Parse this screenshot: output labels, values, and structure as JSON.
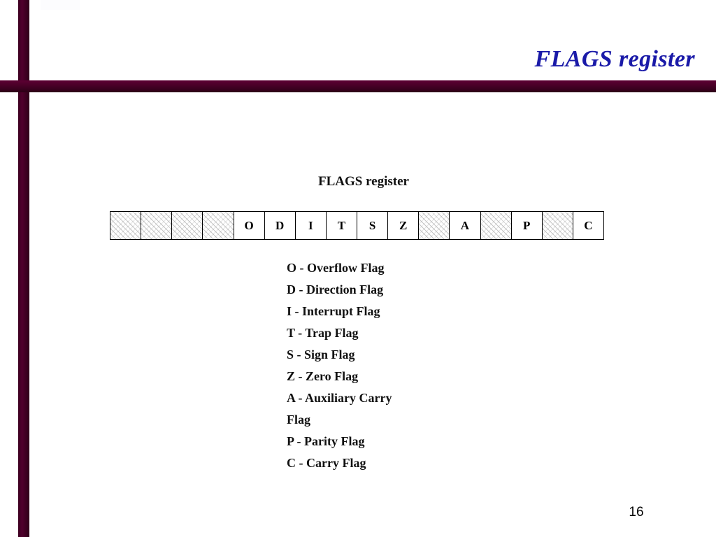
{
  "slide": {
    "title": "FLAGS register",
    "page_number": "16",
    "accent_color": "#4a0028",
    "title_color": "#1a1aa8"
  },
  "diagram": {
    "caption": "FLAGS register",
    "cells": [
      {
        "label": "",
        "hatched": true
      },
      {
        "label": "",
        "hatched": true
      },
      {
        "label": "",
        "hatched": true
      },
      {
        "label": "",
        "hatched": true
      },
      {
        "label": "O",
        "hatched": false
      },
      {
        "label": "D",
        "hatched": false
      },
      {
        "label": "I",
        "hatched": false
      },
      {
        "label": "T",
        "hatched": false
      },
      {
        "label": "S",
        "hatched": false
      },
      {
        "label": "Z",
        "hatched": false
      },
      {
        "label": "",
        "hatched": true
      },
      {
        "label": "A",
        "hatched": false
      },
      {
        "label": "",
        "hatched": true
      },
      {
        "label": "P",
        "hatched": false
      },
      {
        "label": "",
        "hatched": true
      },
      {
        "label": "C",
        "hatched": false
      }
    ]
  },
  "legend": {
    "lines": [
      "O - Overflow Flag",
      "D - Direction Flag",
      "I - Interrupt Flag",
      "T - Trap Flag",
      "S - Sign Flag",
      "Z - Zero Flag",
      "A - Auxiliary Carry",
      "Flag",
      "P - Parity Flag",
      "C - Carry Flag"
    ]
  }
}
